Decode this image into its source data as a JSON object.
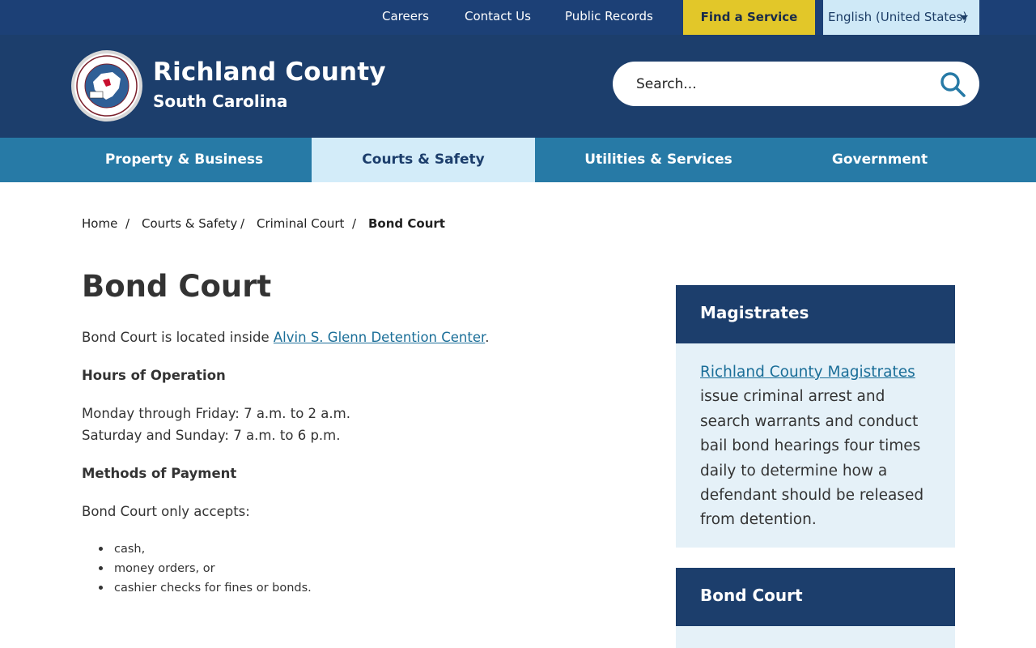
{
  "utility_nav": {
    "links": [
      "Careers",
      "Contact Us",
      "Public Records"
    ],
    "cta": "Find a Service",
    "language": "English (United States)"
  },
  "header": {
    "title": "Richland County",
    "subtitle": "South Carolina",
    "search_placeholder": "Search..."
  },
  "main_nav": {
    "items": [
      "Property & Business",
      "Courts & Safety",
      "Utilities & Services",
      "Government"
    ],
    "active": "Courts & Safety"
  },
  "breadcrumb": {
    "items": [
      "Home",
      "Courts & Safety",
      "Criminal Court"
    ],
    "separator": "/",
    "current": "Bond Court"
  },
  "content": {
    "title": "Bond Court",
    "intro_prefix": "Bond Court is located inside ",
    "intro_link": "Alvin S. Glenn Detention Center",
    "intro_suffix": ".",
    "hours_heading": "Hours of Operation",
    "hours": [
      "Monday through Friday: 7 a.m. to 2 a.m.",
      "Saturday and Sunday: 7 a.m. to 6 p.m."
    ],
    "payment_heading": "Methods of Payment",
    "payment_intro": "Bond Court only accepts:",
    "payment_methods": [
      "cash,",
      "money orders, or",
      "cashier checks for fines or bonds."
    ]
  },
  "sidebar": {
    "magistrates": {
      "heading": "Magistrates",
      "link": "Richland County Magistrates",
      "text": "issue criminal arrest and search warrants and conduct bail bond hearings four times daily to determine how a defendant should be released from detention."
    },
    "bond_court": {
      "heading": "Bond Court"
    }
  },
  "colors": {
    "utility_bar": "#1c4076",
    "header": "#1c3e6c",
    "nav": "#277aa6",
    "nav_active": "#d3ecf9",
    "cta": "#e2c729",
    "link": "#1a6e98",
    "card_body": "#e5f1f8"
  },
  "icons": {
    "search": "search-icon",
    "language_caret": "chevron-down-icon",
    "logo": "county-seal-logo"
  }
}
